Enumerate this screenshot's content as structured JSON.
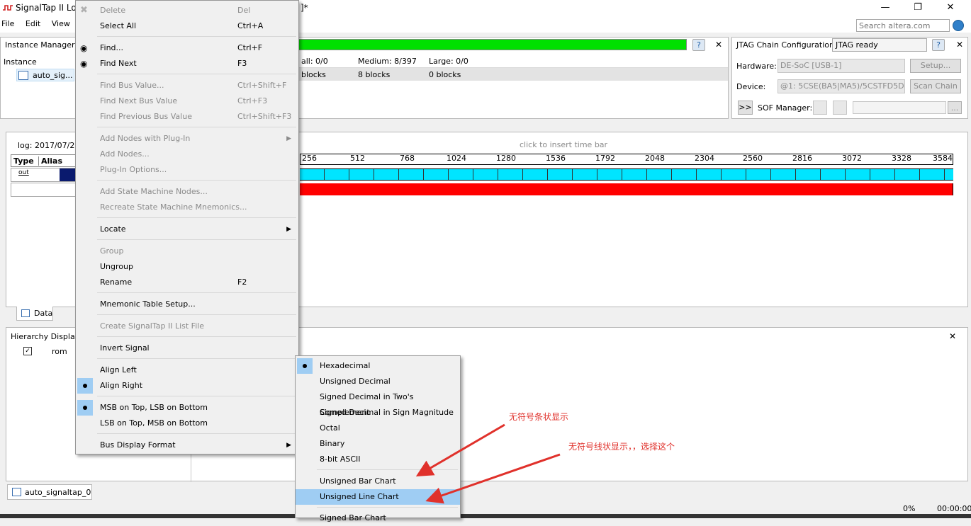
{
  "window": {
    "title": "SignalTap II Lo",
    "title_suffix": "]*",
    "minimize": "—",
    "maximize": "❐",
    "close": "✕"
  },
  "menu": {
    "file": "File",
    "edit": "Edit",
    "view": "View"
  },
  "search": {
    "placeholder": "Search altera.com"
  },
  "instance_manager": {
    "label": "Instance Manager:",
    "col_instance": "Instance",
    "instance_name": "auto_sig...",
    "small": "all: 0/0",
    "medium": "Medium: 8/397",
    "large": "Large: 0/0",
    "small_blocks": "blocks",
    "medium_blocks": "8 blocks",
    "large_blocks": "0 blocks"
  },
  "jtag": {
    "label": "JTAG Chain Configuration:",
    "status": "JTAG ready",
    "hardware_label": "Hardware:",
    "hardware_value": "DE-SoC [USB-1]",
    "setup_button": "Setup...",
    "device_label": "Device:",
    "device_value": "@1: 5CSE(BA5|MA5)/5CSTFD5D",
    "scan_chain_button": "Scan Chain",
    "sof_toggle": ">>",
    "sof_label": "SOF Manager:",
    "browse_button": "..."
  },
  "waveform": {
    "log_label": "log: 2017/07/29 1",
    "col_type": "Type",
    "col_alias": "Alias",
    "insert_time_bar": "click to insert time bar",
    "ticks": [
      "256",
      "512",
      "768",
      "1024",
      "1280",
      "1536",
      "1792",
      "2048",
      "2304",
      "2560",
      "2816",
      "3072",
      "3328",
      "3584"
    ],
    "tab_data": "Data",
    "out_icon_label": "out"
  },
  "hierarchy": {
    "label": "Hierarchy Display:",
    "node": "rom"
  },
  "bottom_tab": {
    "instance": "auto_signaltap_0"
  },
  "status_bar": {
    "percent": "0%",
    "time": "00:00:00"
  },
  "context_menu": {
    "delete": "Delete",
    "delete_sc": "Del",
    "select_all": "Select All",
    "select_all_sc": "Ctrl+A",
    "find": "Find...",
    "find_sc": "Ctrl+F",
    "find_next": "Find Next",
    "find_next_sc": "F3",
    "find_bus": "Find Bus Value...",
    "find_bus_sc": "Ctrl+Shift+F",
    "find_next_bus": "Find Next Bus Value",
    "find_next_bus_sc": "Ctrl+F3",
    "find_prev_bus": "Find Previous Bus Value",
    "find_prev_bus_sc": "Ctrl+Shift+F3",
    "add_nodes_plugin": "Add Nodes with Plug-In",
    "add_nodes": "Add Nodes...",
    "plugin_options": "Plug-In Options...",
    "add_state_machine": "Add State Machine Nodes...",
    "recreate_state_machine": "Recreate State Machine Mnemonics...",
    "locate": "Locate",
    "group": "Group",
    "ungroup": "Ungroup",
    "rename": "Rename",
    "rename_sc": "F2",
    "mnemonic_table": "Mnemonic Table Setup...",
    "create_list_file": "Create SignalTap II List File",
    "invert_signal": "Invert Signal",
    "align_left": "Align Left",
    "align_right": "Align Right",
    "msb_top": "MSB on Top, LSB on Bottom",
    "lsb_top": "LSB on Top, MSB on Bottom",
    "bus_display_format": "Bus Display Format"
  },
  "submenu": {
    "hexadecimal": "Hexadecimal",
    "unsigned_decimal": "Unsigned Decimal",
    "signed_twos": "Signed Decimal in Two's Complement",
    "signed_magnitude": "Signed Decimal in Sign Magnitude",
    "octal": "Octal",
    "binary": "Binary",
    "ascii": "8-bit ASCII",
    "unsigned_bar": "Unsigned Bar Chart",
    "unsigned_line": "Unsigned Line Chart",
    "signed_bar": "Signed Bar Chart"
  },
  "annotations": {
    "bar_note": "无符号条状显示",
    "line_note": "无符号线状显示，，选择这个",
    "color": "#e0312b"
  },
  "colors": {
    "progress_green": "#00e000",
    "signal_cyan": "#00e5ff",
    "signal_red": "#ff0000",
    "menu_highlight": "#9fcdf3"
  }
}
